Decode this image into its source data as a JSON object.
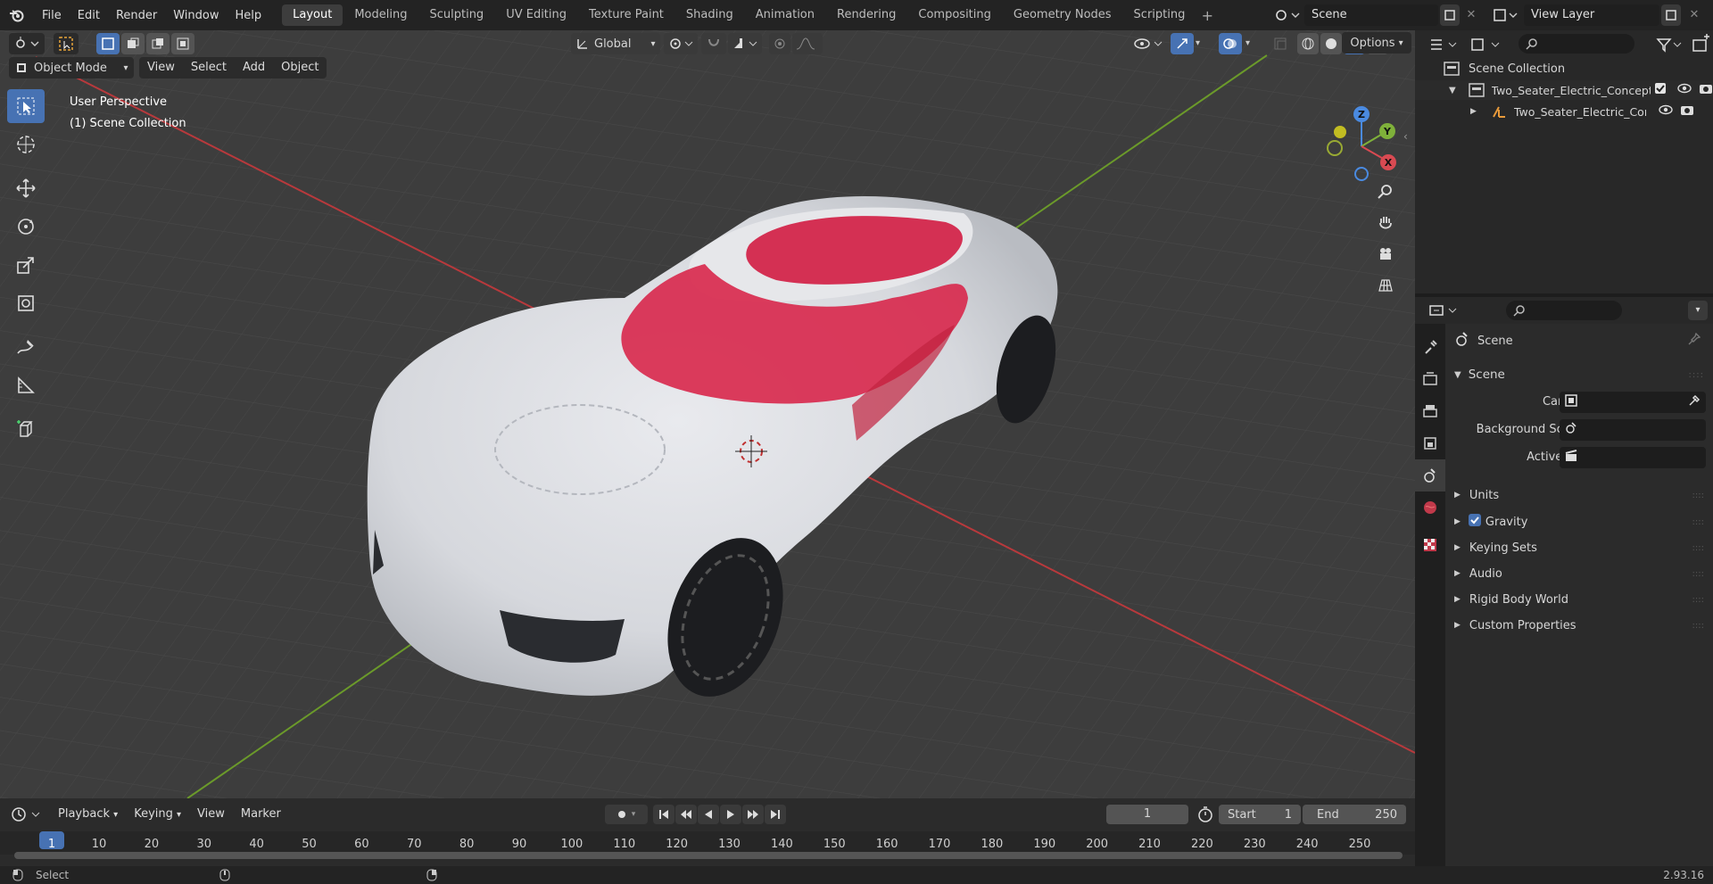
{
  "topbar": {
    "menus": [
      "File",
      "Edit",
      "Render",
      "Window",
      "Help"
    ],
    "workspaces": [
      "Layout",
      "Modeling",
      "Sculpting",
      "UV Editing",
      "Texture Paint",
      "Shading",
      "Animation",
      "Rendering",
      "Compositing",
      "Geometry Nodes",
      "Scripting"
    ],
    "active_workspace": "Layout",
    "scene_name": "Scene",
    "view_layer": "View Layer"
  },
  "viewport": {
    "mode": "Object Mode",
    "menus": [
      "View",
      "Select",
      "Add",
      "Object"
    ],
    "transform_orientation": "Global",
    "options_label": "Options",
    "overlay_title": "User Perspective",
    "overlay_collection": "(1) Scene Collection",
    "gizmo_axes": {
      "x": "X",
      "y": "Y",
      "z": "Z"
    },
    "colors": {
      "background": "#3d3d3d",
      "x_axis": "#c0393a",
      "y_axis": "#6b9a2a",
      "car_body": "#dcdee3",
      "car_accent": "#d8204a"
    }
  },
  "outliner": {
    "root": "Scene Collection",
    "items": [
      {
        "label": "Two_Seater_Electric_Concept_",
        "level": 1
      },
      {
        "label": "Two_Seater_Electric_Con",
        "level": 2
      }
    ]
  },
  "properties": {
    "context": "Scene",
    "section": "Scene",
    "fields": [
      {
        "label": "Camera",
        "value": ""
      },
      {
        "label": "Background Scene",
        "value": ""
      },
      {
        "label": "Active Clip",
        "value": ""
      }
    ],
    "panels": [
      "Units",
      "Gravity",
      "Keying Sets",
      "Audio",
      "Rigid Body World",
      "Custom Properties"
    ],
    "gravity_checked": true
  },
  "timeline": {
    "menus": [
      "Playback",
      "Keying",
      "View",
      "Marker"
    ],
    "current_frame": "1",
    "start_label": "Start",
    "start_value": "1",
    "end_label": "End",
    "end_value": "250",
    "ticks": [
      "1",
      "10",
      "20",
      "30",
      "40",
      "50",
      "60",
      "70",
      "80",
      "90",
      "100",
      "110",
      "120",
      "130",
      "140",
      "150",
      "160",
      "170",
      "180",
      "190",
      "200",
      "210",
      "220",
      "230",
      "240",
      "250"
    ]
  },
  "statusbar": {
    "left": "Select",
    "version": "2.93.16"
  }
}
